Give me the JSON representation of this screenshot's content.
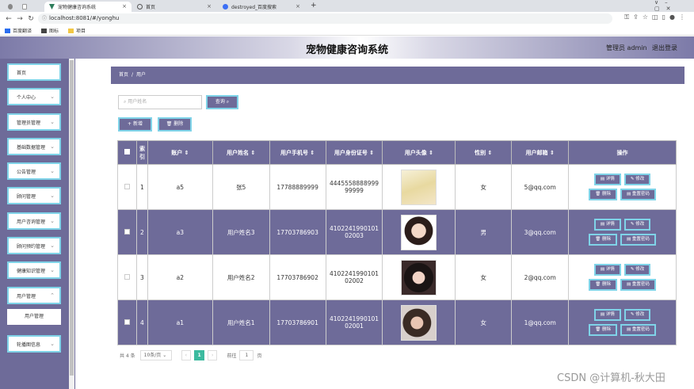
{
  "browser": {
    "tabs": [
      {
        "label": ""
      },
      {
        "label": ""
      },
      {
        "label": "宠物健康咨询系统"
      },
      {
        "label": "首页"
      },
      {
        "label": "destroyed_百度搜索"
      }
    ],
    "url": "localhost:8081/#/yonghu",
    "bookmarks": [
      "百度翻译",
      "图标",
      "项目"
    ]
  },
  "header": {
    "title": "宠物健康咨询系统",
    "admin": "管理员 admin",
    "logout": "退出登录"
  },
  "sidebar": {
    "items": [
      {
        "label": "首页"
      },
      {
        "label": "个人中心"
      },
      {
        "label": "管理员管理"
      },
      {
        "label": "基础数据管理"
      },
      {
        "label": "公告管理"
      },
      {
        "label": "顾问管理"
      },
      {
        "label": "用户咨询管理"
      },
      {
        "label": "顾问预约管理"
      },
      {
        "label": "健康知识管理"
      },
      {
        "label": "用户管理"
      },
      {
        "label": "用户管理"
      },
      {
        "label": "轮播图信息"
      }
    ]
  },
  "breadcrumb": {
    "home": "首页",
    "sep": "/",
    "current": "用户"
  },
  "search": {
    "placeholder": "用户姓名",
    "button": "查询"
  },
  "actions": {
    "add": "+ 新增",
    "delete": "删除"
  },
  "table": {
    "headers": [
      "索引",
      "账户",
      "用户姓名",
      "用户手机号",
      "用户身份证号",
      "用户头像",
      "性别",
      "用户邮箱",
      "操作"
    ],
    "rows": [
      {
        "index": "1",
        "account": "a5",
        "name": "张5",
        "phone": "17788889999",
        "idcard": "444555888899999999",
        "gender": "女",
        "email": "5@qq.com"
      },
      {
        "index": "2",
        "account": "a3",
        "name": "用户姓名3",
        "phone": "17703786903",
        "idcard": "410224199010102003",
        "gender": "男",
        "email": "3@qq.com"
      },
      {
        "index": "3",
        "account": "a2",
        "name": "用户姓名2",
        "phone": "17703786902",
        "idcard": "410224199010102002",
        "gender": "女",
        "email": "2@qq.com"
      },
      {
        "index": "4",
        "account": "a1",
        "name": "用户姓名1",
        "phone": "17703786901",
        "idcard": "410224199010102001",
        "gender": "女",
        "email": "1@qq.com"
      }
    ],
    "row_actions": {
      "detail": "详情",
      "edit": "修改",
      "delete": "删除",
      "reset": "重置密码"
    }
  },
  "pager": {
    "total": "共 4 条",
    "size": "10条/页",
    "prev": "‹",
    "page": "1",
    "next": "›",
    "goto": "前往",
    "goto_val": "1",
    "suffix": "页"
  },
  "watermark": "CSDN @计算机-秋大田",
  "colors": {
    "primary": "#6e6b99",
    "border_accent": "#7fd3e8",
    "pager_active": "#3cba9f"
  }
}
